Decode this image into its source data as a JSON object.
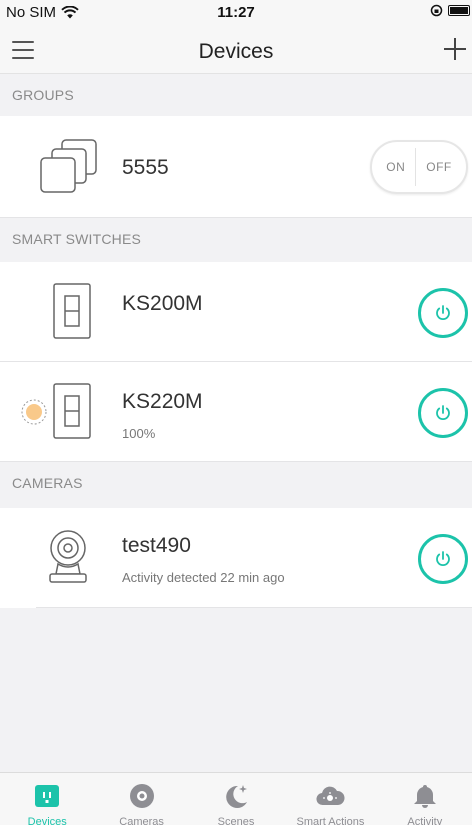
{
  "status_bar": {
    "carrier": "No SIM",
    "time": "11:27"
  },
  "nav": {
    "title": "Devices",
    "menu_icon": "hamburger-icon",
    "add_icon": "plus-icon"
  },
  "sections": {
    "groups": "GROUPS",
    "smart_switches": "SMART SWITCHES",
    "cameras": "CAMERAS"
  },
  "groups": [
    {
      "name": "5555",
      "on_label": "ON",
      "off_label": "OFF"
    }
  ],
  "switches": [
    {
      "name": "KS200M",
      "subtitle": ""
    },
    {
      "name": "KS220M",
      "subtitle": "100%"
    }
  ],
  "cameras": [
    {
      "name": "test490",
      "subtitle": "Activity detected 22 min ago"
    }
  ],
  "tabs": [
    {
      "label": "Devices",
      "icon": "devices-icon",
      "active": true
    },
    {
      "label": "Cameras",
      "icon": "camera-icon",
      "active": false
    },
    {
      "label": "Scenes",
      "icon": "moon-icon",
      "active": false
    },
    {
      "label": "Smart Actions",
      "icon": "cloud-icon",
      "active": false
    },
    {
      "label": "Activity",
      "icon": "bell-icon",
      "active": false
    }
  ],
  "colors": {
    "accent": "#1cc3aa",
    "dimmer_dot": "#f9c98a"
  }
}
